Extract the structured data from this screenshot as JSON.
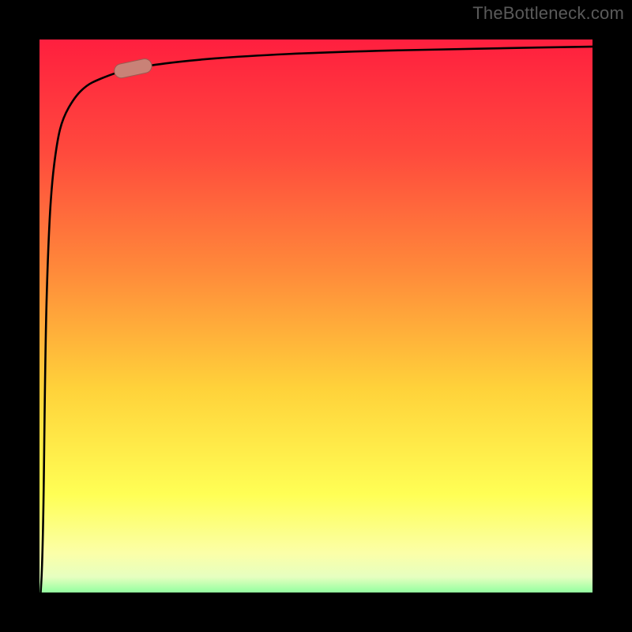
{
  "attribution": "TheBottleneck.com",
  "colors": {
    "frame": "#000000",
    "curve": "#000000",
    "marker_fill": "#c98277",
    "marker_stroke": "#9b5a50",
    "gradient_stops": [
      {
        "offset": 0.0,
        "color": "#ff193f"
      },
      {
        "offset": 0.22,
        "color": "#ff4a3d"
      },
      {
        "offset": 0.42,
        "color": "#ff8a3a"
      },
      {
        "offset": 0.62,
        "color": "#ffd23a"
      },
      {
        "offset": 0.8,
        "color": "#ffff55"
      },
      {
        "offset": 0.9,
        "color": "#fbffa8"
      },
      {
        "offset": 0.94,
        "color": "#e6ffc0"
      },
      {
        "offset": 1.0,
        "color": "#2bff76"
      }
    ],
    "attribution_text": "#5a5a5a"
  },
  "chart_data": {
    "type": "line",
    "title": "",
    "xlabel": "",
    "ylabel": "",
    "xlim": [
      0,
      100
    ],
    "ylim": [
      0,
      100
    ],
    "grid": false,
    "legend": false,
    "series": [
      {
        "name": "bottleneck-curve",
        "description": "Steep logarithmic-style curve: near-vertical at left edge, turns over around x≈10–20 and becomes near-horizontal, asymptotically approaching y≈96.",
        "x": [
          0.0,
          0.6,
          1.0,
          1.4,
          2.0,
          3.0,
          4.0,
          6.0,
          8.0,
          10.0,
          14.0,
          18.0,
          25.0,
          35.0,
          50.0,
          70.0,
          100.0
        ],
        "y": [
          0.0,
          10.0,
          45.0,
          60.0,
          72.0,
          80.0,
          84.0,
          87.5,
          89.5,
          90.5,
          92.0,
          92.8,
          93.7,
          94.5,
          95.2,
          95.7,
          96.2
        ]
      }
    ],
    "marker": {
      "description": "Short rounded pill highlighting a tangent segment on the curve near its 'knee'.",
      "cx": 16.0,
      "cy": 92.4,
      "length": 6.5,
      "angle_deg": 12,
      "thickness": 2.4
    },
    "background_gradient": {
      "direction": "vertical",
      "stops_ref": "colors.gradient_stops"
    }
  }
}
